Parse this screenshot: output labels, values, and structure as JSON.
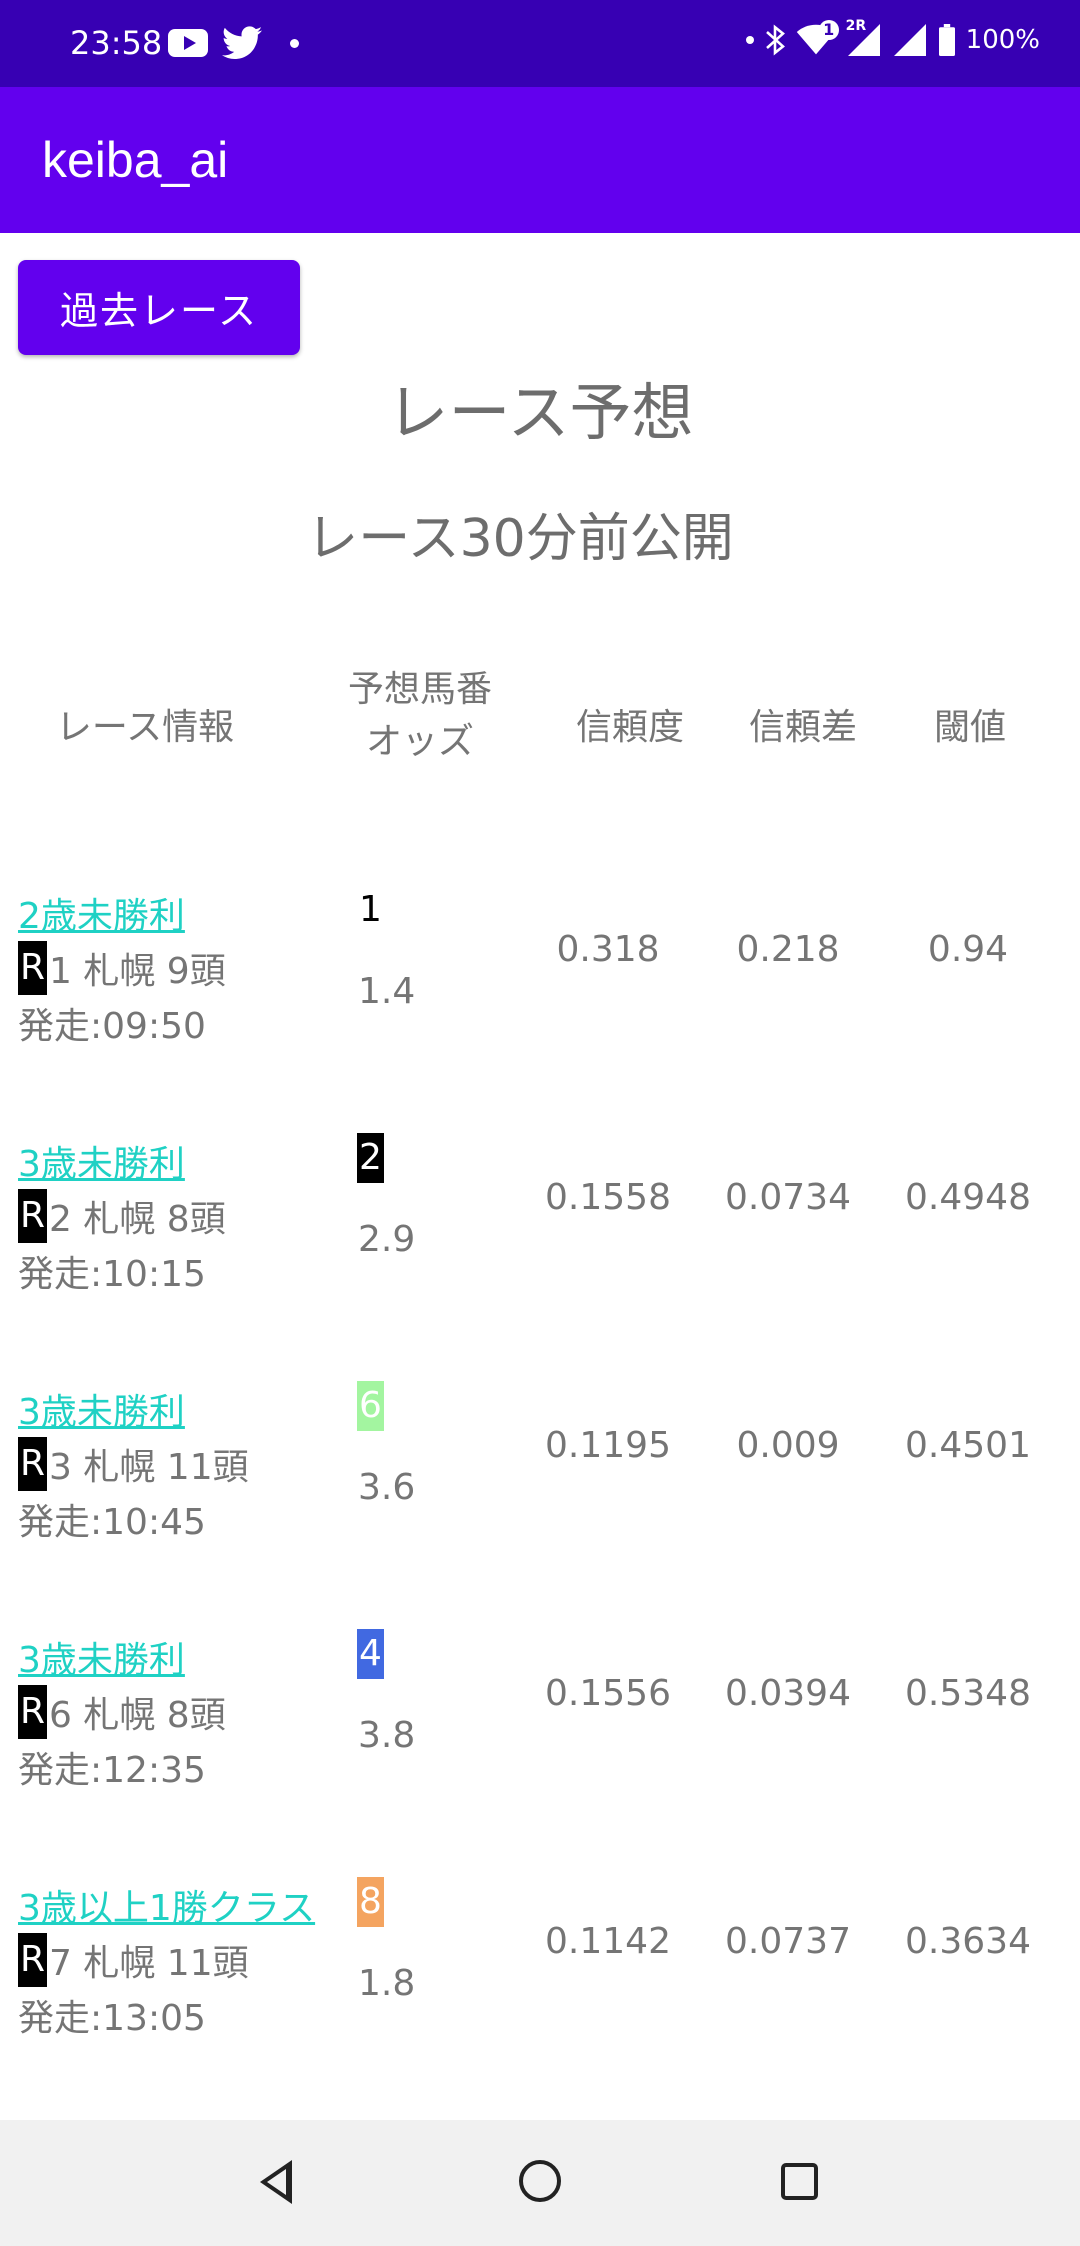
{
  "status_bar": {
    "time": "23:58",
    "left_icons": [
      "youtube-icon",
      "twitter-icon",
      "notification-dot-icon"
    ],
    "right_icons": [
      "dot-icon",
      "bluetooth-icon",
      "wifi-icon",
      "signal-icon",
      "signal-icon",
      "battery-icon"
    ],
    "wifi_badge": "1",
    "signal_badge": "2R",
    "battery": "100%"
  },
  "app_bar": {
    "title": "keiba_ai"
  },
  "past_button": {
    "label": "過去レース"
  },
  "page": {
    "title": "レース予想",
    "subtitle": "レース30分前公開"
  },
  "table": {
    "headers": {
      "race_info": "レース情報",
      "horse_line1": "予想馬番",
      "horse_line2": "オッズ",
      "confidence": "信頼度",
      "confidence_diff": "信頼差",
      "threshold": "閾値"
    },
    "rows": [
      {
        "race_name": "2歳未勝利",
        "r_label": "R",
        "race_detail": "1 札幌 9頭",
        "start": "発走:09:50",
        "horse_num": "1",
        "horse_bg": "#ffffff",
        "horse_fg": "#000000",
        "odds": "1.4",
        "confidence": "0.318",
        "diff": "0.218",
        "threshold": "0.94"
      },
      {
        "race_name": "3歳未勝利",
        "r_label": "R",
        "race_detail": "2 札幌 8頭",
        "start": "発走:10:15",
        "horse_num": "2",
        "horse_bg": "#000000",
        "horse_fg": "#ffffff",
        "odds": "2.9",
        "confidence": "0.1558",
        "diff": "0.0734",
        "threshold": "0.4948"
      },
      {
        "race_name": "3歳未勝利",
        "r_label": "R",
        "race_detail": "3 札幌 11頭",
        "start": "発走:10:45",
        "horse_num": "6",
        "horse_bg": "#a3f5a0",
        "horse_fg": "#ffffff",
        "odds": "3.6",
        "confidence": "0.1195",
        "diff": "0.009",
        "threshold": "0.4501"
      },
      {
        "race_name": "3歳未勝利",
        "r_label": "R",
        "race_detail": "6 札幌 8頭",
        "start": "発走:12:35",
        "horse_num": "4",
        "horse_bg": "#4169e1",
        "horse_fg": "#ffffff",
        "odds": "3.8",
        "confidence": "0.1556",
        "diff": "0.0394",
        "threshold": "0.5348"
      },
      {
        "race_name": "3歳以上1勝クラス",
        "r_label": "R",
        "race_detail": "7 札幌 11頭",
        "start": "発走:13:05",
        "horse_num": "8",
        "horse_bg": "#f4a460",
        "horse_fg": "#ffffff",
        "odds": "1.8",
        "confidence": "0.1142",
        "diff": "0.0737",
        "threshold": "0.3634"
      }
    ]
  },
  "nav_bar": {
    "icons": [
      "back-icon",
      "home-icon",
      "recents-icon"
    ]
  }
}
